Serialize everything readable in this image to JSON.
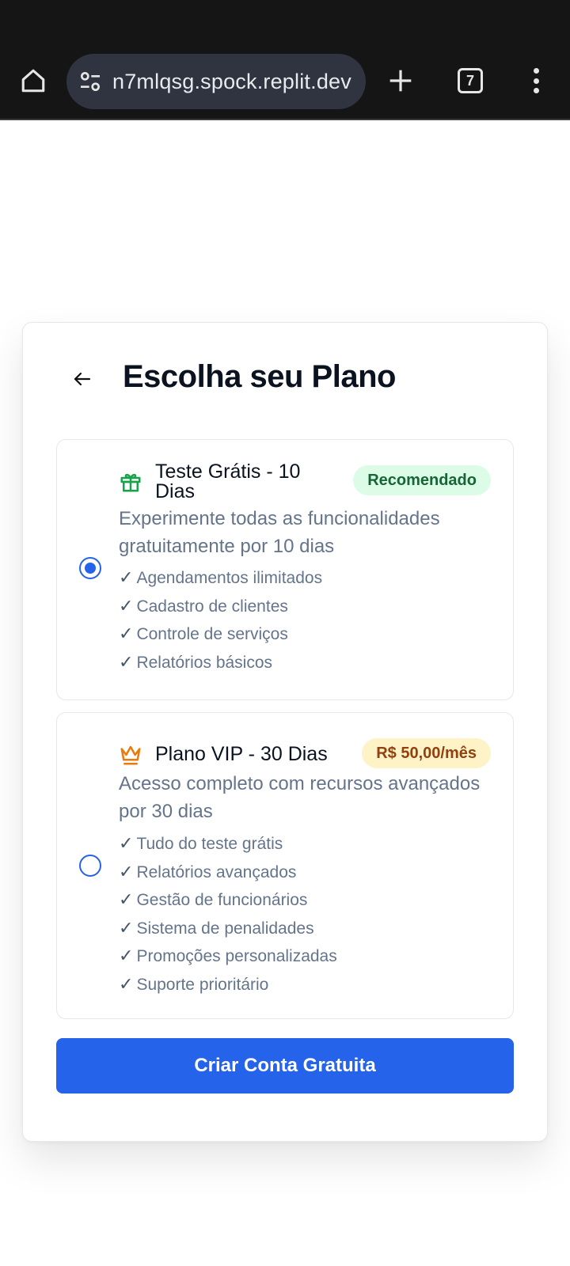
{
  "browser": {
    "url": "n7mlqsg.spock.replit.dev",
    "tab_count": "7"
  },
  "page": {
    "title": "Escolha seu Plano"
  },
  "plans": [
    {
      "name": "Teste Grátis - 10 Dias",
      "badge": "Recomendado",
      "description": "Experimente todas as funcionalidades gratuitamente por 10 dias",
      "selected": true,
      "icon": "gift-icon",
      "features": [
        "Agendamentos ilimitados",
        "Cadastro de clientes",
        "Controle de serviços",
        "Relatórios básicos"
      ]
    },
    {
      "name": "Plano VIP - 30 Dias",
      "badge": "R$ 50,00/mês",
      "description": "Acesso completo com recursos avançados por 30 dias",
      "selected": false,
      "icon": "crown-icon",
      "features": [
        "Tudo do teste grátis",
        "Relatórios avançados",
        "Gestão de funcionários",
        "Sistema de penalidades",
        "Promoções personalizadas",
        "Suporte prioritário"
      ]
    }
  ],
  "feature_check": "✓",
  "cta": {
    "label": "Criar Conta Gratuita"
  },
  "colors": {
    "primary": "#2563eb",
    "recommended_badge_bg": "#dcfce7",
    "recommended_badge_text": "#166534",
    "price_badge_bg": "#fef3c7",
    "price_badge_text": "#92400e",
    "gift_icon": "#16a34a",
    "crown_icon": "#ea7a0b"
  }
}
